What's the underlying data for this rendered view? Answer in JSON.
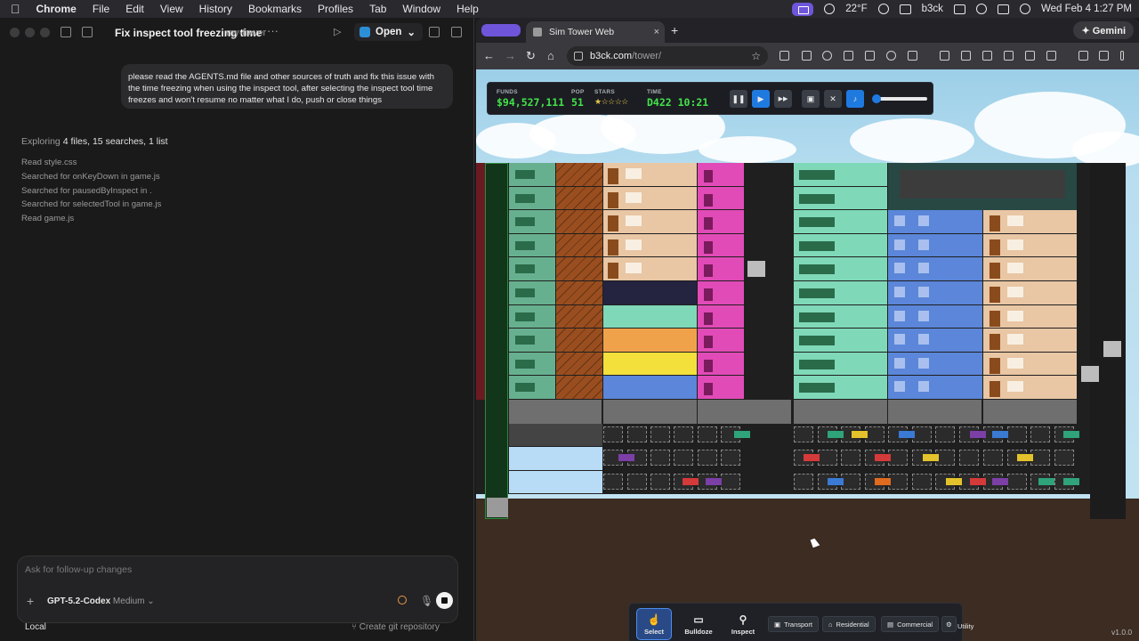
{
  "menubar": {
    "apple": "",
    "app": "Chrome",
    "items": [
      "File",
      "Edit",
      "View",
      "History",
      "Bookmarks",
      "Profiles",
      "Tab",
      "Window",
      "Help"
    ],
    "weather": "22°F",
    "user": "b3ck",
    "datetime": "Wed Feb 4  1:27 PM"
  },
  "codex": {
    "title": "Fix inspect tool freezing time",
    "repo": "my-tower",
    "more": "···",
    "run": "▷",
    "open_label": "Open",
    "user_message": "please read the AGENTS.md file and other sources of truth and fix this issue with the time freezing when using the inspect tool, after selecting the inspect tool time freezes and won't resume no matter what I do, push or close things",
    "explore_prefix": "Exploring",
    "explore_summary": "4 files, 15 searches, 1 list",
    "steps": [
      "Read style.css",
      "Searched for onKeyDown in game.js",
      "Searched for pausedByInspect in .",
      "Searched for selectedTool in game.js",
      "Read game.js"
    ],
    "composer_placeholder": "Ask for follow-up changes",
    "plus": "+",
    "model": "GPT-5.2-Codex",
    "effort": "Medium ⌄",
    "mic": "🎙",
    "env": "Local",
    "git": "⑂ Create git repository"
  },
  "chrome": {
    "tab_title": "Sim Tower Web",
    "tab_close": "×",
    "new_tab": "+",
    "gemini": "✦ Gemini",
    "back": "←",
    "forward": "→",
    "reload": "↻",
    "home": "⌂",
    "url_host": "b3ck.com",
    "url_path": "/tower/",
    "bookmark": "☆"
  },
  "hud": {
    "funds_label": "FUNDS",
    "funds": "$94,527,111",
    "pop_label": "POP",
    "pop": "51",
    "stars_label": "STARS",
    "stars": "★☆☆☆☆",
    "time_label": "TIME",
    "time": "D422 10:21",
    "pause": "❚❚",
    "play": "▶",
    "fast": "▶▶",
    "save": "▣",
    "mute": "✕",
    "music": "♪",
    "volume": 0.05
  },
  "toolbar": {
    "select": "Select",
    "bulldoze": "Bulldoze",
    "inspect": "Inspect",
    "transport": "Transport",
    "residential": "Residential",
    "commercial": "Commercial",
    "utility": "Utility"
  },
  "version": "v1.0.0",
  "colors": {
    "office": "#67b08f",
    "stairs": "#9a4e1f",
    "hotel": "#e9c6a4",
    "shop": "#e14bb7",
    "office_light": "#7fd9b8",
    "condo_blue": "#5b86d9",
    "dark_room": "#242340",
    "lobby": "#6f6f6f",
    "parking": "#2b2b2b"
  }
}
